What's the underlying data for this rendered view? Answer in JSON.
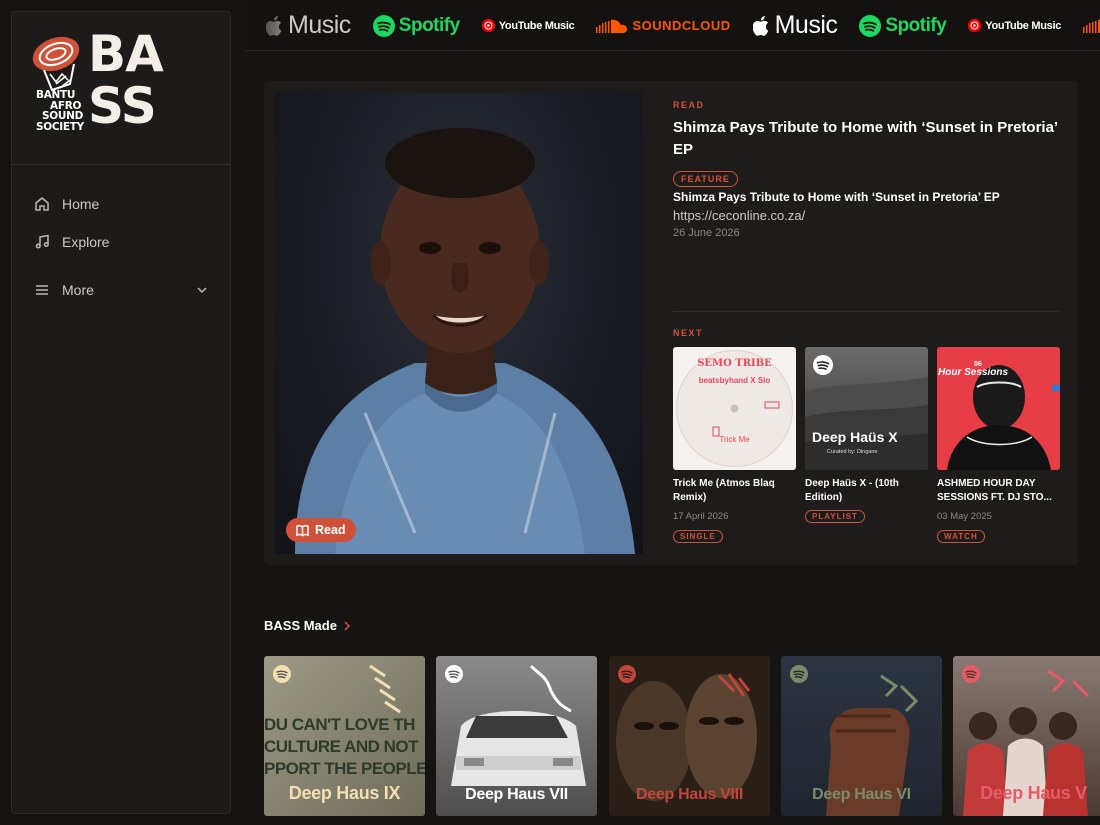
{
  "sidebar": {
    "logo": {
      "small_lines": [
        "BANTU",
        "AFRO",
        "SOUND",
        "SOCIETY"
      ],
      "big_lines": [
        "BA",
        "SS"
      ]
    },
    "items": [
      {
        "label": "Home",
        "icon": "home-icon"
      },
      {
        "label": "Explore",
        "icon": "music-note-icon"
      },
      {
        "label": "More",
        "icon": "menu-icon"
      }
    ]
  },
  "topbar": {
    "brands": [
      {
        "name": "Music",
        "type": "apple"
      },
      {
        "name": "Spotify",
        "type": "spotify"
      },
      {
        "name": "YouTube Music",
        "type": "youtube"
      },
      {
        "name": "SOUNDCLOUD",
        "type": "soundcloud"
      },
      {
        "name": "Music",
        "type": "apple"
      },
      {
        "name": "Spotify",
        "type": "spotify"
      },
      {
        "name": "YouTube Music",
        "type": "youtube"
      }
    ]
  },
  "hero": {
    "kicker": "READ",
    "title": "Shimza Pays Tribute to Home with ‘Sunset in Pretoria’ EP",
    "badge": "FEATURE",
    "subtitle": "Shimza Pays Tribute to Home with ‘Sunset in Pretoria’ EP",
    "source": "https://ceconline.co.za/",
    "date": "26 June 2026",
    "read_button": "Read",
    "next_label": "NEXT"
  },
  "next_cards": [
    {
      "title": "Trick Me (Atmos Blaq Remix)",
      "date": "17 April 2026",
      "badge": "SINGLE",
      "art_title": "Trick Me",
      "art_line": "beatsbyhand X Sio",
      "art_brand": "SEMO TRIBE"
    },
    {
      "title": "Deep Haüs X - (10th Edition)",
      "date": "",
      "badge": "PLAYLIST",
      "art_title": "Deep Haüs X",
      "art_line": "Curated by: Dingane"
    },
    {
      "title": "ASHMED HOUR DAY SESSIONS FT. DJ STO...",
      "date": "03 May 2025",
      "badge": "WATCH",
      "art_title": "Hour Sessions",
      "art_line": "06"
    }
  ],
  "bass_made": {
    "title": "BASS Made",
    "tiles": [
      {
        "label": "Deep Haus IX",
        "color": "#f3dfb3"
      },
      {
        "label": "Deep Haus VII",
        "color": "#ffffff"
      },
      {
        "label": "Deep Haus VIII",
        "color": "#c0453a"
      },
      {
        "label": "Deep Haus VI",
        "color": "#7d8a6a"
      },
      {
        "label": "Deep Haus V",
        "color": "#e85a66"
      }
    ],
    "tile1_text": [
      "DU CAN'T LOVE TH",
      "CULTURE AND NOT",
      "PPORT THE PEOPLE"
    ]
  },
  "colors": {
    "accent": "#d0513a",
    "spotify": "#1ed760",
    "background": "#161412",
    "panel": "#1e1c1a"
  }
}
